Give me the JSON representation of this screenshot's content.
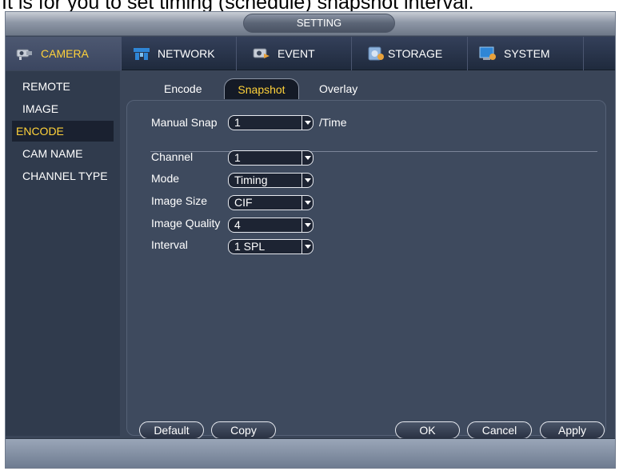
{
  "caption": "It is for you to set timing (schedule) snapshot interval.",
  "window": {
    "title": "SETTING"
  },
  "main_tabs": [
    {
      "label": "CAMERA",
      "icon": "camera-icon"
    },
    {
      "label": "NETWORK",
      "icon": "network-icon"
    },
    {
      "label": "EVENT",
      "icon": "event-icon"
    },
    {
      "label": "STORAGE",
      "icon": "storage-icon"
    },
    {
      "label": "SYSTEM",
      "icon": "system-icon"
    }
  ],
  "sidebar": {
    "items": [
      {
        "label": "REMOTE"
      },
      {
        "label": "IMAGE"
      },
      {
        "label": "ENCODE"
      },
      {
        "label": "CAM NAME"
      },
      {
        "label": "CHANNEL TYPE"
      }
    ]
  },
  "sub_tabs": [
    {
      "label": "Encode"
    },
    {
      "label": "Snapshot"
    },
    {
      "label": "Overlay"
    }
  ],
  "form": {
    "manual_snap": {
      "label": "Manual Snap",
      "value": "1",
      "unit": "/Time"
    },
    "channel": {
      "label": "Channel",
      "value": "1"
    },
    "mode": {
      "label": "Mode",
      "value": "Timing"
    },
    "image_size": {
      "label": "Image Size",
      "value": "CIF"
    },
    "image_quality": {
      "label": "Image Quality",
      "value": "4"
    },
    "interval": {
      "label": "Interval",
      "value": "1 SPL"
    }
  },
  "buttons": {
    "default": "Default",
    "copy": "Copy",
    "ok": "OK",
    "cancel": "Cancel",
    "apply": "Apply"
  },
  "colors": {
    "accent": "#ffd23a",
    "panel": "#3e4a5e",
    "background": "#3a4558"
  }
}
